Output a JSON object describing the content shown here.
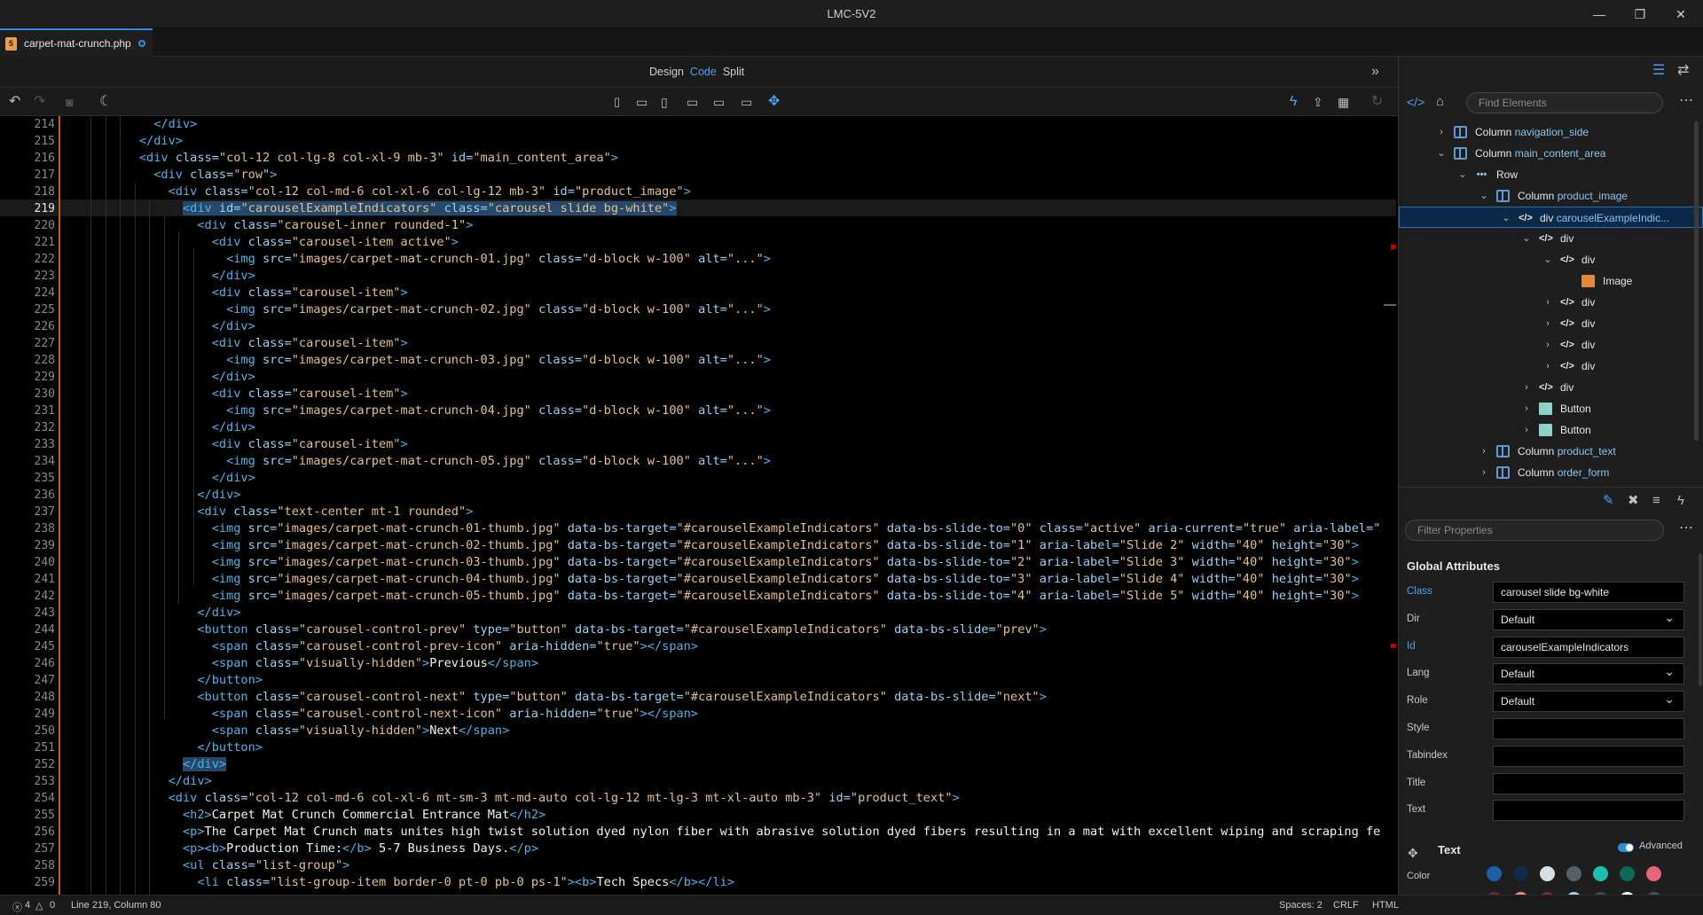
{
  "window": {
    "title": "LMC-5V2",
    "minimize": "—",
    "restore": "❐",
    "close": "✕"
  },
  "file_tab": {
    "name": "carpet-mat-crunch.php",
    "icon": "php-file-icon"
  },
  "view_modes": {
    "design": "Design",
    "code": "Code",
    "split": "Split",
    "active": "Code"
  },
  "code": {
    "lines": [
      {
        "n": "214",
        "html": "            <span class=\"t\">&lt;/div&gt;</span>"
      },
      {
        "n": "215",
        "html": "          <span class=\"t\">&lt;/div&gt;</span>"
      },
      {
        "n": "216",
        "html": "          <span class=\"t\">&lt;div</span> <span class=\"a\">class=</span><span class=\"s\">\"col-12 col-lg-8 col-xl-9 mb-3\"</span> <span class=\"a\">id=</span><span class=\"s\">\"main_content_area\"</span><span class=\"t\">&gt;</span>"
      },
      {
        "n": "217",
        "html": "            <span class=\"t\">&lt;div</span> <span class=\"a\">class=</span><span class=\"s\">\"row\"</span><span class=\"t\">&gt;</span>"
      },
      {
        "n": "218",
        "html": "              <span class=\"t\">&lt;div</span> <span class=\"a\">class=</span><span class=\"s\">\"col-12 col-md-6 col-xl-6 col-lg-12 mb-3\"</span> <span class=\"a\">id=</span><span class=\"s\">\"product_image\"</span><span class=\"t\">&gt;</span>"
      },
      {
        "n": "219",
        "html": "                <span class=\"sel\"><span class=\"t\">&lt;div</span> <span class=\"a\">id=</span><span class=\"s\">\"carouselExampleIndicators\"</span> <span class=\"a\">class=</span><span class=\"s\">\"carousel slide bg-white\"</span><span class=\"t\">&gt;</span></span>"
      },
      {
        "n": "220",
        "html": "                  <span class=\"t\">&lt;div</span> <span class=\"a\">class=</span><span class=\"s\">\"carousel-inner rounded-1\"</span><span class=\"t\">&gt;</span>"
      },
      {
        "n": "221",
        "html": "                    <span class=\"t\">&lt;div</span> <span class=\"a\">class=</span><span class=\"s\">\"carousel-item active\"</span><span class=\"t\">&gt;</span>"
      },
      {
        "n": "222",
        "html": "                      <span class=\"t\">&lt;img</span> <span class=\"a\">src=</span><span class=\"s\">\"images/carpet-mat-crunch-01.jpg\"</span> <span class=\"a\">class=</span><span class=\"s\">\"d-block w-100\"</span> <span class=\"a\">alt=</span><span class=\"s\">\"...\"</span><span class=\"t\">&gt;</span>"
      },
      {
        "n": "223",
        "html": "                    <span class=\"t\">&lt;/div&gt;</span>"
      },
      {
        "n": "224",
        "html": "                    <span class=\"t\">&lt;div</span> <span class=\"a\">class=</span><span class=\"s\">\"carousel-item\"</span><span class=\"t\">&gt;</span>"
      },
      {
        "n": "225",
        "html": "                      <span class=\"t\">&lt;img</span> <span class=\"a\">src=</span><span class=\"s\">\"images/carpet-mat-crunch-02.jpg\"</span> <span class=\"a\">class=</span><span class=\"s\">\"d-block w-100\"</span> <span class=\"a\">alt=</span><span class=\"s\">\"...\"</span><span class=\"t\">&gt;</span>"
      },
      {
        "n": "226",
        "html": "                    <span class=\"t\">&lt;/div&gt;</span>"
      },
      {
        "n": "227",
        "html": "                    <span class=\"t\">&lt;div</span> <span class=\"a\">class=</span><span class=\"s\">\"carousel-item\"</span><span class=\"t\">&gt;</span>"
      },
      {
        "n": "228",
        "html": "                      <span class=\"t\">&lt;img</span> <span class=\"a\">src=</span><span class=\"s\">\"images/carpet-mat-crunch-03.jpg\"</span> <span class=\"a\">class=</span><span class=\"s\">\"d-block w-100\"</span> <span class=\"a\">alt=</span><span class=\"s\">\"...\"</span><span class=\"t\">&gt;</span>"
      },
      {
        "n": "229",
        "html": "                    <span class=\"t\">&lt;/div&gt;</span>"
      },
      {
        "n": "230",
        "html": "                    <span class=\"t\">&lt;div</span> <span class=\"a\">class=</span><span class=\"s\">\"carousel-item\"</span><span class=\"t\">&gt;</span>"
      },
      {
        "n": "231",
        "html": "                      <span class=\"t\">&lt;img</span> <span class=\"a\">src=</span><span class=\"s\">\"images/carpet-mat-crunch-04.jpg\"</span> <span class=\"a\">class=</span><span class=\"s\">\"d-block w-100\"</span> <span class=\"a\">alt=</span><span class=\"s\">\"...\"</span><span class=\"t\">&gt;</span>"
      },
      {
        "n": "232",
        "html": "                    <span class=\"t\">&lt;/div&gt;</span>"
      },
      {
        "n": "233",
        "html": "                    <span class=\"t\">&lt;div</span> <span class=\"a\">class=</span><span class=\"s\">\"carousel-item\"</span><span class=\"t\">&gt;</span>"
      },
      {
        "n": "234",
        "html": "                      <span class=\"t\">&lt;img</span> <span class=\"a\">src=</span><span class=\"s\">\"images/carpet-mat-crunch-05.jpg\"</span> <span class=\"a\">class=</span><span class=\"s\">\"d-block w-100\"</span> <span class=\"a\">alt=</span><span class=\"s\">\"...\"</span><span class=\"t\">&gt;</span>"
      },
      {
        "n": "235",
        "html": "                    <span class=\"t\">&lt;/div&gt;</span>"
      },
      {
        "n": "236",
        "html": "                  <span class=\"t\">&lt;/div&gt;</span>"
      },
      {
        "n": "237",
        "html": "                  <span class=\"t\">&lt;div</span> <span class=\"a\">class=</span><span class=\"s\">\"text-center mt-1 rounded\"</span><span class=\"t\">&gt;</span>"
      },
      {
        "n": "238",
        "html": "                    <span class=\"t\">&lt;img</span> <span class=\"a\">src=</span><span class=\"s\">\"images/carpet-mat-crunch-01-thumb.jpg\"</span> <span class=\"a\">data-bs-target=</span><span class=\"s\">\"#carouselExampleIndicators\"</span> <span class=\"a\">data-bs-slide-to=</span><span class=\"s\">\"0\"</span> <span class=\"a\">class=</span><span class=\"s\">\"active\"</span> <span class=\"a\">aria-current=</span><span class=\"s\">\"true\"</span> <span class=\"a\">aria-label=</span><span class=\"s\">\"</span>"
      },
      {
        "n": "239",
        "html": "                    <span class=\"t\">&lt;img</span> <span class=\"a\">src=</span><span class=\"s\">\"images/carpet-mat-crunch-02-thumb.jpg\"</span> <span class=\"a\">data-bs-target=</span><span class=\"s\">\"#carouselExampleIndicators\"</span> <span class=\"a\">data-bs-slide-to=</span><span class=\"s\">\"1\"</span> <span class=\"a\">aria-label=</span><span class=\"s\">\"Slide 2\"</span> <span class=\"a\">width=</span><span class=\"s\">\"40\"</span> <span class=\"a\">height=</span><span class=\"s\">\"30\"</span><span class=\"t\">&gt;</span>"
      },
      {
        "n": "240",
        "html": "                    <span class=\"t\">&lt;img</span> <span class=\"a\">src=</span><span class=\"s\">\"images/carpet-mat-crunch-03-thumb.jpg\"</span> <span class=\"a\">data-bs-target=</span><span class=\"s\">\"#carouselExampleIndicators\"</span> <span class=\"a\">data-bs-slide-to=</span><span class=\"s\">\"2\"</span> <span class=\"a\">aria-label=</span><span class=\"s\">\"Slide 3\"</span> <span class=\"a\">width=</span><span class=\"s\">\"40\"</span> <span class=\"a\">height=</span><span class=\"s\">\"30\"</span><span class=\"t\">&gt;</span>"
      },
      {
        "n": "241",
        "html": "                    <span class=\"t\">&lt;img</span> <span class=\"a\">src=</span><span class=\"s\">\"images/carpet-mat-crunch-04-thumb.jpg\"</span> <span class=\"a\">data-bs-target=</span><span class=\"s\">\"#carouselExampleIndicators\"</span> <span class=\"a\">data-bs-slide-to=</span><span class=\"s\">\"3\"</span> <span class=\"a\">aria-label=</span><span class=\"s\">\"Slide 4\"</span> <span class=\"a\">width=</span><span class=\"s\">\"40\"</span> <span class=\"a\">height=</span><span class=\"s\">\"30\"</span><span class=\"t\">&gt;</span>"
      },
      {
        "n": "242",
        "html": "                    <span class=\"t\">&lt;img</span> <span class=\"a\">src=</span><span class=\"s\">\"images/carpet-mat-crunch-05-thumb.jpg\"</span> <span class=\"a\">data-bs-target=</span><span class=\"s\">\"#carouselExampleIndicators\"</span> <span class=\"a\">data-bs-slide-to=</span><span class=\"s\">\"4\"</span> <span class=\"a\">aria-label=</span><span class=\"s\">\"Slide 5\"</span> <span class=\"a\">width=</span><span class=\"s\">\"40\"</span> <span class=\"a\">height=</span><span class=\"s\">\"30\"</span><span class=\"t\">&gt;</span>"
      },
      {
        "n": "243",
        "html": "                  <span class=\"t\">&lt;/div&gt;</span>"
      },
      {
        "n": "244",
        "html": "                  <span class=\"t\">&lt;button</span> <span class=\"a\">class=</span><span class=\"s\">\"carousel-control-prev\"</span> <span class=\"a\">type=</span><span class=\"s\">\"button\"</span> <span class=\"a\">data-bs-target=</span><span class=\"s\">\"#carouselExampleIndicators\"</span> <span class=\"a\">data-bs-slide=</span><span class=\"s\">\"prev\"</span><span class=\"t\">&gt;</span>"
      },
      {
        "n": "245",
        "html": "                    <span class=\"t\">&lt;span</span> <span class=\"a\">class=</span><span class=\"s\">\"carousel-control-prev-icon\"</span> <span class=\"a\">aria-hidden=</span><span class=\"s\">\"true\"</span><span class=\"t\">&gt;&lt;/span&gt;</span>"
      },
      {
        "n": "246",
        "html": "                    <span class=\"t\">&lt;span</span> <span class=\"a\">class=</span><span class=\"s\">\"visually-hidden\"</span><span class=\"t\">&gt;</span><span class=\"tx\">Previous</span><span class=\"t\">&lt;/span&gt;</span>"
      },
      {
        "n": "247",
        "html": "                  <span class=\"t\">&lt;/button&gt;</span>"
      },
      {
        "n": "248",
        "html": "                  <span class=\"t\">&lt;button</span> <span class=\"a\">class=</span><span class=\"s\">\"carousel-control-next\"</span> <span class=\"a\">type=</span><span class=\"s\">\"button\"</span> <span class=\"a\">data-bs-target=</span><span class=\"s\">\"#carouselExampleIndicators\"</span> <span class=\"a\">data-bs-slide=</span><span class=\"s\">\"next\"</span><span class=\"t\">&gt;</span>"
      },
      {
        "n": "249",
        "html": "                    <span class=\"t\">&lt;span</span> <span class=\"a\">class=</span><span class=\"s\">\"carousel-control-next-icon\"</span> <span class=\"a\">aria-hidden=</span><span class=\"s\">\"true\"</span><span class=\"t\">&gt;&lt;/span&gt;</span>"
      },
      {
        "n": "250",
        "html": "                    <span class=\"t\">&lt;span</span> <span class=\"a\">class=</span><span class=\"s\">\"visually-hidden\"</span><span class=\"t\">&gt;</span><span class=\"tx\">Next</span><span class=\"t\">&lt;/span&gt;</span>"
      },
      {
        "n": "251",
        "html": "                  <span class=\"t\">&lt;/button&gt;</span>"
      },
      {
        "n": "252",
        "html": "                <span class=\"sel\"><span class=\"t\">&lt;/div&gt;</span></span>"
      },
      {
        "n": "253",
        "html": "              <span class=\"t\">&lt;/div&gt;</span>"
      },
      {
        "n": "254",
        "html": "              <span class=\"t\">&lt;div</span> <span class=\"a\">class=</span><span class=\"s\">\"col-12 col-md-6 col-xl-6 mt-sm-3 mt-md-auto col-lg-12 mt-lg-3 mt-xl-auto mb-3\"</span> <span class=\"a\">id=</span><span class=\"s\">\"product_text\"</span><span class=\"t\">&gt;</span>"
      },
      {
        "n": "255",
        "html": "                <span class=\"t\">&lt;h2&gt;</span><span class=\"tx\">Carpet Mat Crunch Commercial Entrance Mat</span><span class=\"t\">&lt;/h2&gt;</span>"
      },
      {
        "n": "256",
        "html": "                <span class=\"t\">&lt;p&gt;</span><span class=\"tx\">The Carpet Mat Crunch mats unites high twist solution dyed nylon fiber with abrasive solution dyed fibers resulting in a mat with excellent wiping and scraping fe</span>"
      },
      {
        "n": "257",
        "html": "                <span class=\"t\">&lt;p&gt;&lt;b&gt;</span><span class=\"tx\">Production Time:</span><span class=\"t\">&lt;/b&gt;</span><span class=\"tx\"> 5-7 Business Days.</span><span class=\"t\">&lt;/p&gt;</span>"
      },
      {
        "n": "258",
        "html": "                <span class=\"t\">&lt;ul</span> <span class=\"a\">class=</span><span class=\"s\">\"list-group\"</span><span class=\"t\">&gt;</span>"
      },
      {
        "n": "259",
        "html": "                  <span class=\"t\">&lt;li</span> <span class=\"a\">class=</span><span class=\"s\">\"list-group-item border-0 pt-0 pb-0 ps-1\"</span><span class=\"t\">&gt;&lt;b&gt;</span><span class=\"tx\">Tech Specs</span><span class=\"t\">&lt;/b&gt;&lt;/li&gt;</span>"
      }
    ]
  },
  "element_panel": {
    "search_placeholder": "Find Elements",
    "tree": [
      {
        "depth": 0,
        "chev": "›",
        "icon": "column",
        "type": "Column",
        "sub": "navigation_side"
      },
      {
        "depth": 0,
        "chev": "⌄",
        "icon": "column",
        "type": "Column",
        "sub": "main_content_area"
      },
      {
        "depth": 1,
        "chev": "⌄",
        "icon": "row",
        "type": "Row",
        "sub": ""
      },
      {
        "depth": 2,
        "chev": "⌄",
        "icon": "column",
        "type": "Column",
        "sub": "product_image"
      },
      {
        "depth": 3,
        "chev": "⌄",
        "icon": "code",
        "type": "div",
        "sub": "carouselExampleIndic...",
        "selected": true
      },
      {
        "depth": 4,
        "chev": "⌄",
        "icon": "code",
        "type": "div",
        "sub": ""
      },
      {
        "depth": 5,
        "chev": "⌄",
        "icon": "code",
        "type": "div",
        "sub": ""
      },
      {
        "depth": 6,
        "chev": "",
        "icon": "image",
        "type": "Image",
        "sub": ""
      },
      {
        "depth": 5,
        "chev": "›",
        "icon": "code",
        "type": "div",
        "sub": ""
      },
      {
        "depth": 5,
        "chev": "›",
        "icon": "code",
        "type": "div",
        "sub": ""
      },
      {
        "depth": 5,
        "chev": "›",
        "icon": "code",
        "type": "div",
        "sub": ""
      },
      {
        "depth": 5,
        "chev": "›",
        "icon": "code",
        "type": "div",
        "sub": ""
      },
      {
        "depth": 4,
        "chev": "›",
        "icon": "code",
        "type": "div",
        "sub": ""
      },
      {
        "depth": 4,
        "chev": "›",
        "icon": "button",
        "type": "Button",
        "sub": ""
      },
      {
        "depth": 4,
        "chev": "›",
        "icon": "button",
        "type": "Button",
        "sub": ""
      },
      {
        "depth": 2,
        "chev": "›",
        "icon": "column",
        "type": "Column",
        "sub": "product_text"
      },
      {
        "depth": 2,
        "chev": "›",
        "icon": "column",
        "type": "Column",
        "sub": "order_form"
      }
    ]
  },
  "properties_panel": {
    "search_placeholder": "Filter Properties",
    "section": "Global Attributes",
    "rows": [
      {
        "label": "Class",
        "value": "carousel slide bg-white",
        "highlight": true,
        "dropdown": false
      },
      {
        "label": "Dir",
        "value": "Default",
        "highlight": false,
        "dropdown": true
      },
      {
        "label": "Id",
        "value": "carouselExampleIndicators",
        "highlight": true,
        "dropdown": false
      },
      {
        "label": "Lang",
        "value": "Default",
        "highlight": false,
        "dropdown": true
      },
      {
        "label": "Role",
        "value": "Default",
        "highlight": false,
        "dropdown": true
      },
      {
        "label": "Style",
        "value": "",
        "highlight": false,
        "dropdown": false
      },
      {
        "label": "Tabindex",
        "value": "",
        "highlight": false,
        "dropdown": false
      },
      {
        "label": "Title",
        "value": "",
        "highlight": false,
        "dropdown": false
      },
      {
        "label": "Text",
        "value": "",
        "highlight": false,
        "dropdown": false
      }
    ],
    "text_section": "Text",
    "advanced_label": "Advanced",
    "color_label": "Color",
    "swatches": [
      "#1f5fa8",
      "#13294b",
      "#d8dee6",
      "#5a5f66",
      "#1fbfb0",
      "#0b6b5b",
      "#e86478",
      "#6b2a2f",
      "#f28a6a",
      "#7a2a2a",
      "#9fd0f0",
      "#3d4a56",
      "#ffffff",
      "#4a4f58"
    ]
  },
  "status": {
    "errors": "4",
    "warnings": "0",
    "position": "Line 219, Column 80",
    "spaces": "Spaces: 2",
    "eol": "CRLF",
    "language": "HTML"
  }
}
